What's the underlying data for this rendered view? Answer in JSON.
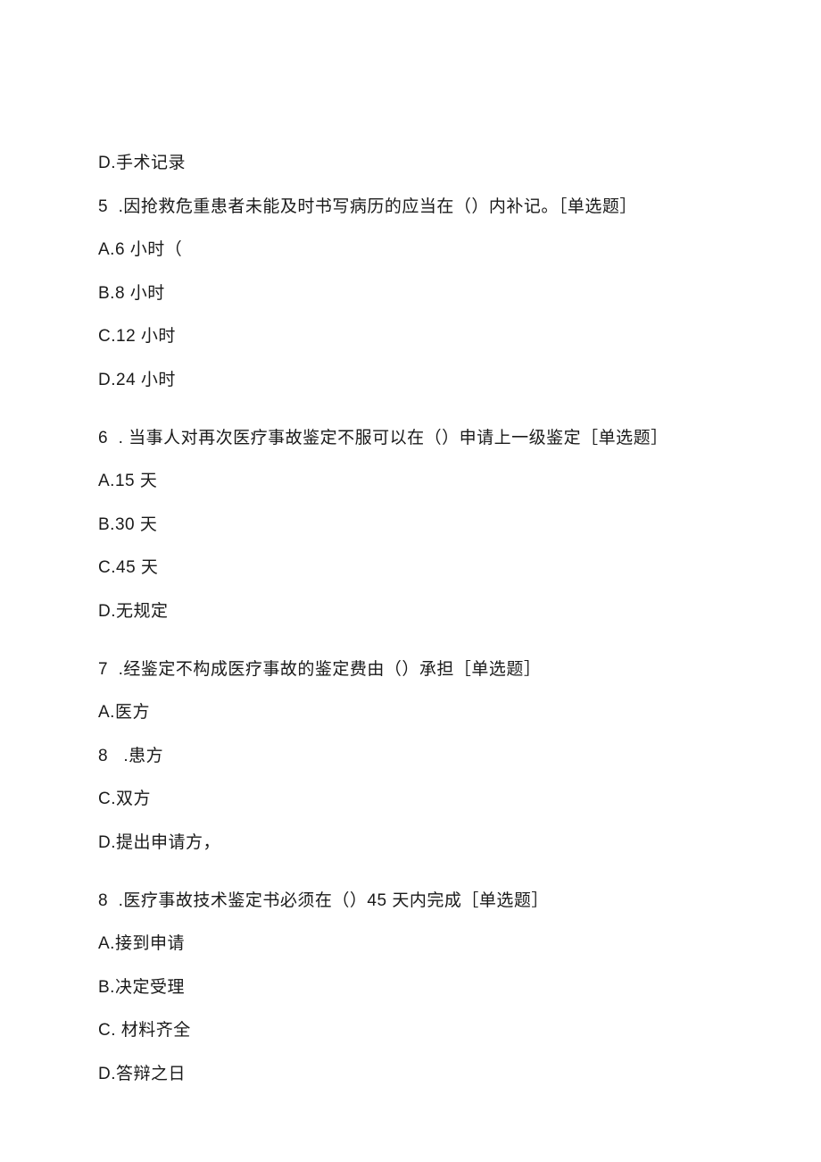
{
  "q4_optionD": "D.手术记录",
  "q5_stem": "5  .因抢救危重患者未能及时书写病历的应当在（）内补记。［单选题］",
  "q5_optA": "A.6 小时（",
  "q5_optB": "B.8 小时",
  "q5_optC": "C.12 小时",
  "q5_optD": "D.24 小时",
  "q6_stem": "6  . 当事人对再次医疗事故鉴定不服可以在（）申请上一级鉴定［单选题］",
  "q6_optA": "A.15 天",
  "q6_optB": "B.30 天",
  "q6_optC": "C.45 天",
  "q6_optD": "D.无规定",
  "q7_stem": "7  .经鉴定不构成医疗事故的鉴定费由（）承担［单选题］",
  "q7_optA": "A.医方",
  "q7_optB": "8   .患方",
  "q7_optC": "C.双方",
  "q7_optD": "D.提出申请方，",
  "q8_stem": "8  .医疗事故技术鉴定书必须在（）45 天内完成［单选题］",
  "q8_optA": "A.接到申请",
  "q8_optB": "B.决定受理",
  "q8_optC": "C. 材料齐全",
  "q8_optD": "D.答辩之日"
}
